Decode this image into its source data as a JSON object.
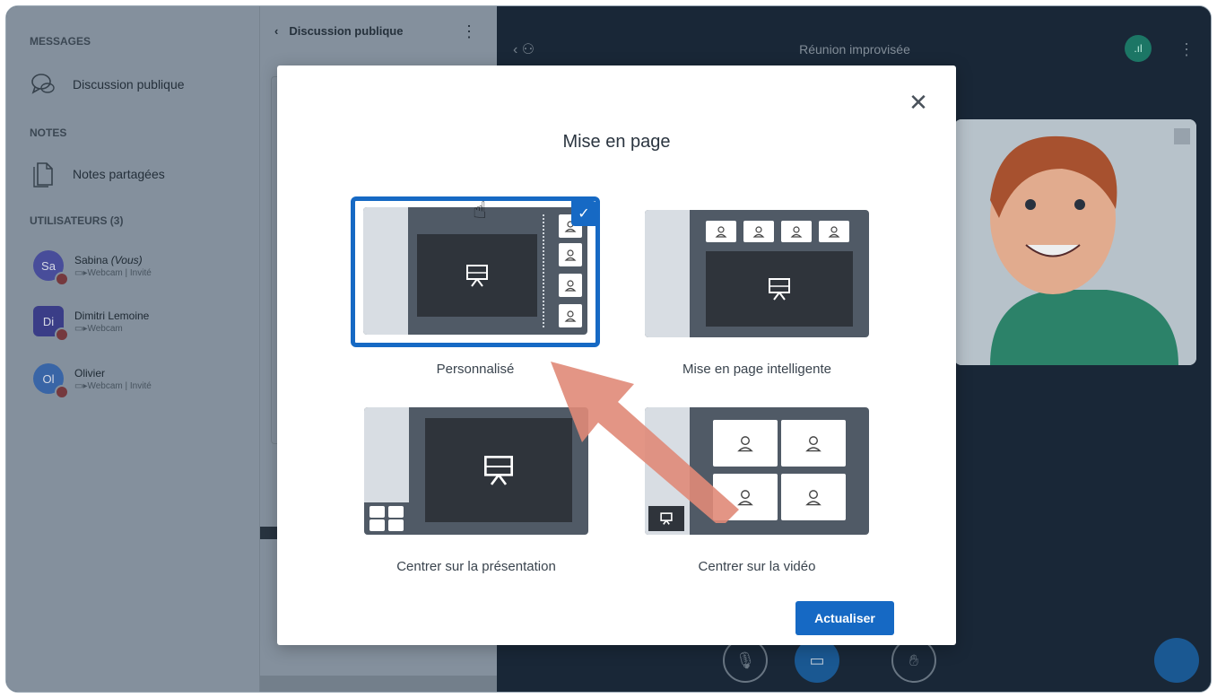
{
  "sidebar": {
    "messages_heading": "MESSAGES",
    "public_chat": "Discussion publique",
    "notes_heading": "NOTES",
    "shared_notes": "Notes partagées",
    "users_heading": "UTILISATEURS (3)",
    "users": [
      {
        "initials": "Sa",
        "name": "Sabina",
        "you": "(Vous)",
        "sub": "Webcam | Invité",
        "color": "#4c51a3"
      },
      {
        "initials": "Di",
        "name": "Dimitri Lemoine",
        "you": "",
        "sub": "Webcam",
        "color": "#3d3f8f"
      },
      {
        "initials": "Ol",
        "name": "Olivier",
        "you": "",
        "sub": "Webcam | Invité",
        "color": "#3c6bb0"
      }
    ]
  },
  "chat": {
    "title": "Discussion publique"
  },
  "main": {
    "meeting_title": "Réunion improvisée"
  },
  "modal": {
    "title": "Mise en page",
    "options": [
      {
        "label": "Personnalisé",
        "selected": true
      },
      {
        "label": "Mise en page intelligente",
        "selected": false
      },
      {
        "label": "Centrer sur la présentation",
        "selected": false
      },
      {
        "label": "Centrer sur la vidéo",
        "selected": false
      }
    ],
    "update_button": "Actualiser"
  },
  "colors": {
    "accent": "#1669c4",
    "annotation_arrow": "#e08a78"
  },
  "icons": [
    "close-icon",
    "check-icon",
    "presentation-icon",
    "user-icon",
    "chat-icon",
    "notes-icon",
    "hand-cursor-icon",
    "microphone-icon",
    "camera-icon",
    "raise-hand-icon",
    "signal-icon",
    "more-icon"
  ]
}
